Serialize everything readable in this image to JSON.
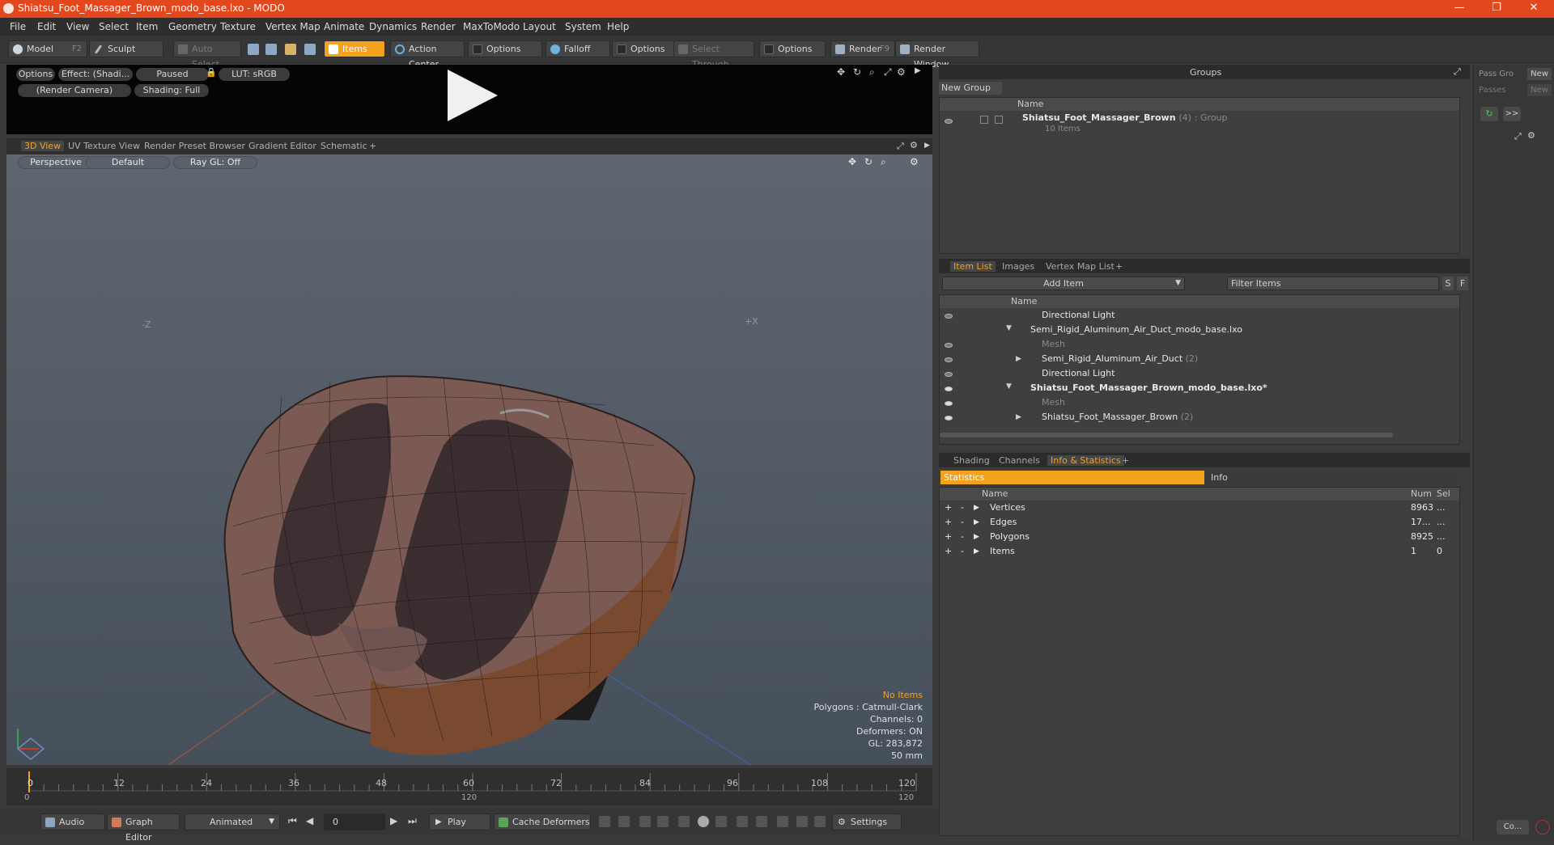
{
  "window": {
    "title": "Shiatsu_Foot_Massager_Brown_modo_base.lxo - MODO",
    "minimize": "—",
    "maximize": "❐",
    "close": "✕"
  },
  "menu": [
    "File",
    "Edit",
    "View",
    "Select",
    "Item",
    "Geometry",
    "Texture",
    "Vertex Map",
    "Animate",
    "Dynamics",
    "Render",
    "MaxToModo",
    "Layout",
    "System",
    "Help"
  ],
  "toolbar": {
    "model": "Model",
    "model_key": "F2",
    "sculpt": "Sculpt",
    "auto_select": "Auto Select",
    "items": "Items",
    "action_center": "Action Center",
    "options1": "Options",
    "falloff": "Falloff",
    "options2": "Options",
    "select_through": "Select Through",
    "options3": "Options",
    "render": "Render",
    "render_key": "F9",
    "render_window": "Render Window"
  },
  "preview": {
    "options": "Options",
    "effect": "Effect: (Shadi...",
    "paused": "Paused",
    "lut": "LUT: sRGB",
    "camera": "(Render Camera)",
    "shading": "Shading: Full"
  },
  "viewtabs": [
    "3D View",
    "UV Texture View",
    "Render Preset Browser",
    "Gradient Editor",
    "Schematic",
    "+"
  ],
  "viewport": {
    "perspective": "Perspective",
    "default": "Default",
    "raygl": "Ray GL: Off",
    "axis_neg_z": "-Z",
    "axis_pos_x": "+X",
    "hud": {
      "no_items": "No Items",
      "polygons": "Polygons : Catmull-Clark",
      "channels": "Channels: 0",
      "deformers": "Deformers: ON",
      "gl": "GL: 283,872",
      "focal": "50 mm"
    }
  },
  "timeline": {
    "ticks": [
      "0",
      "12",
      "24",
      "36",
      "48",
      "60",
      "72",
      "84",
      "96",
      "108",
      "120"
    ],
    "start": "0",
    "mid": "120",
    "end": "120"
  },
  "bottombar": {
    "audio": "Audio",
    "graph_editor": "Graph Editor",
    "animated": "Animated",
    "frame": "0",
    "play": "Play",
    "cache_deformers": "Cache Deformers",
    "settings": "Settings"
  },
  "groups": {
    "title": "Groups",
    "new_group": "New Group",
    "name_col": "Name",
    "item_name": "Shiatsu_Foot_Massager_Brown",
    "item_count": "(4)",
    "item_type": ": Group",
    "item_sub": "10 Items"
  },
  "itemlist": {
    "tabs": [
      "Item List",
      "Images",
      "Vertex Map List",
      "+"
    ],
    "add_item": "Add Item",
    "filter": "Filter Items",
    "s": "S",
    "f": "F",
    "name_col": "Name",
    "rows": [
      {
        "label": "Directional Light",
        "count": ""
      },
      {
        "label": "Semi_Rigid_Aluminum_Air_Duct_modo_base.lxo",
        "count": ""
      },
      {
        "label": "Mesh",
        "count": ""
      },
      {
        "label": "Semi_Rigid_Aluminum_Air_Duct",
        "count": "(2)"
      },
      {
        "label": "Directional Light",
        "count": ""
      },
      {
        "label": "Shiatsu_Foot_Massager_Brown_modo_base.lxo*",
        "count": ""
      },
      {
        "label": "Mesh",
        "count": ""
      },
      {
        "label": "Shiatsu_Foot_Massager_Brown",
        "count": "(2)"
      }
    ]
  },
  "stats": {
    "tabs": [
      "Shading",
      "Channels",
      "Info & Statistics",
      "+"
    ],
    "statistics": "Statistics",
    "info": "Info",
    "cols": {
      "name": "Name",
      "num": "Num",
      "sel": "Sel"
    },
    "rows": [
      {
        "name": "Vertices",
        "num": "8963",
        "sel": "..."
      },
      {
        "name": "Edges",
        "num": "17...",
        "sel": "..."
      },
      {
        "name": "Polygons",
        "num": "8925",
        "sel": "..."
      },
      {
        "name": "Items",
        "num": "1",
        "sel": "0"
      }
    ]
  },
  "rightstrip": {
    "pass_group": "Pass Gro",
    "passes": "Passes",
    "new1": "New",
    "new2": "New",
    "more": ">>",
    "co": "Co..."
  },
  "colors": {
    "accent": "#f3a21c",
    "titlebar": "#e2471e"
  }
}
